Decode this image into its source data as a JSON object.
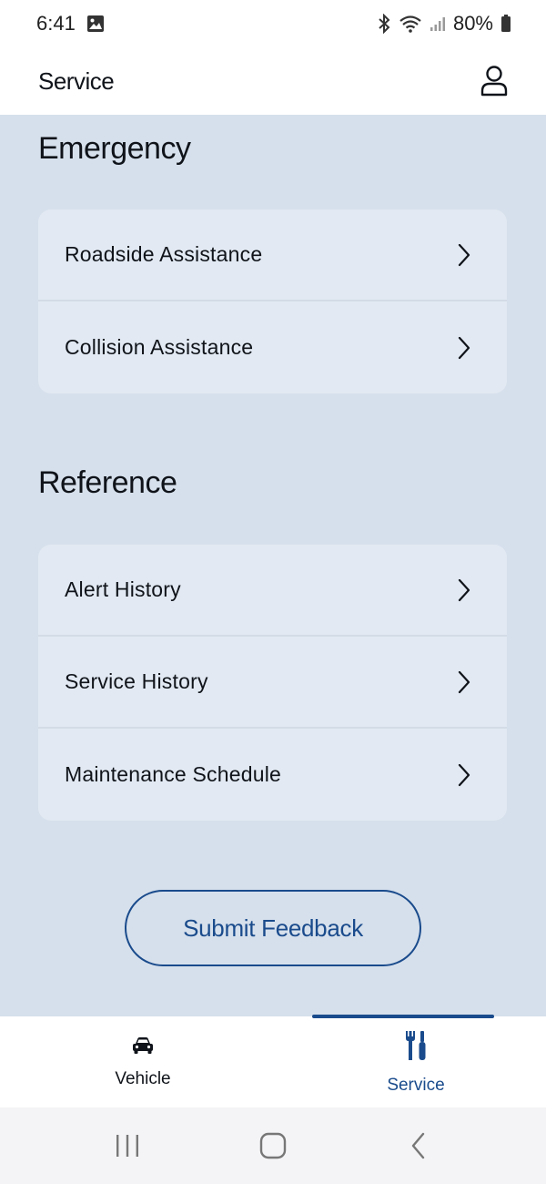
{
  "status_bar": {
    "time": "6:41",
    "battery": "80%"
  },
  "header": {
    "title": "Service"
  },
  "sections": [
    {
      "heading": "Emergency",
      "items": [
        {
          "label": "Roadside Assistance"
        },
        {
          "label": "Collision Assistance"
        }
      ]
    },
    {
      "heading": "Reference",
      "items": [
        {
          "label": "Alert History"
        },
        {
          "label": "Service History"
        },
        {
          "label": "Maintenance Schedule"
        }
      ]
    }
  ],
  "feedback": {
    "label": "Submit Feedback"
  },
  "bottom_nav": {
    "tabs": [
      {
        "label": "Vehicle",
        "icon": "car-icon",
        "active": false
      },
      {
        "label": "Service",
        "icon": "wrench-screwdriver-icon",
        "active": true
      }
    ]
  },
  "colors": {
    "accent": "#1a4b8c",
    "background": "#d6e0ec",
    "card": "#e2e9f2"
  }
}
